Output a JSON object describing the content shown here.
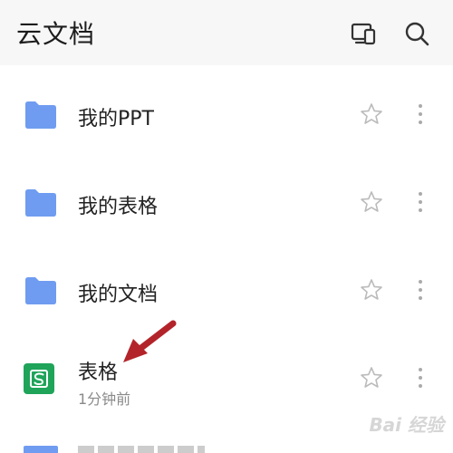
{
  "header": {
    "title": "云文档",
    "icons": [
      "devices-icon",
      "search-icon"
    ]
  },
  "files": [
    {
      "name": "我的PPT",
      "type": "folder"
    },
    {
      "name": "我的表格",
      "type": "folder"
    },
    {
      "name": "我的文档",
      "type": "folder"
    },
    {
      "name": "表格",
      "type": "spreadsheet",
      "time": "1分钟前",
      "icon_letter": "S"
    }
  ],
  "colors": {
    "folder": "#6f9cf0",
    "spreadsheet": "#1fa45a",
    "annotation_arrow": "#b3242a"
  },
  "watermark": "Bai 经验"
}
